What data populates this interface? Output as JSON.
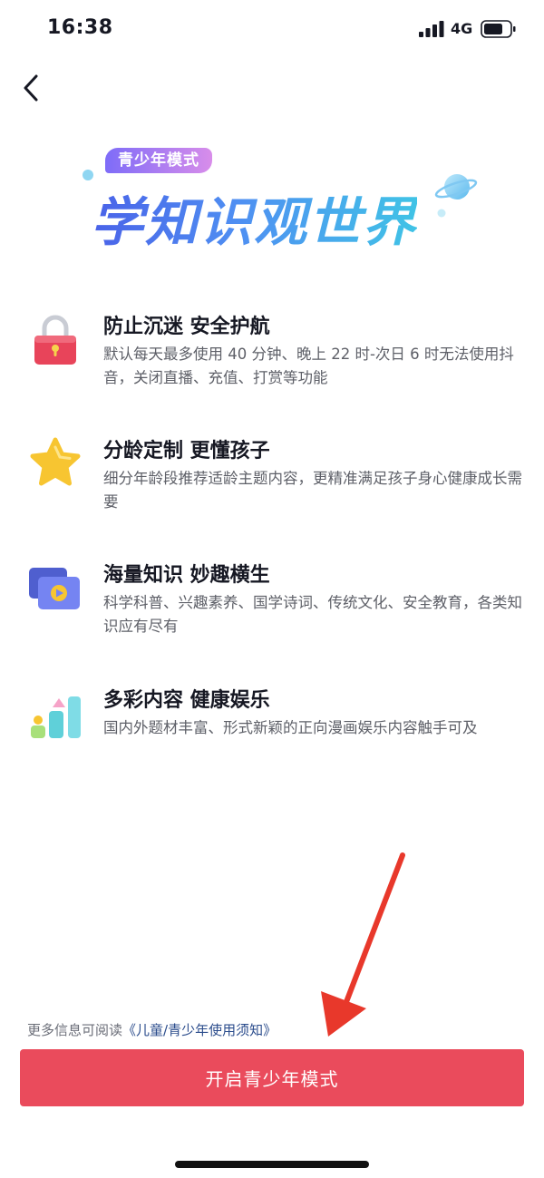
{
  "status_bar": {
    "time": "16:38",
    "network": "4G",
    "icons": [
      "signal-icon",
      "battery-icon"
    ]
  },
  "nav": {
    "back_icon": "chevron-left-icon"
  },
  "hero": {
    "badge": "青少年模式",
    "title": "学知识观世界"
  },
  "features": [
    {
      "icon": "lock-icon",
      "title": "防止沉迷 安全护航",
      "description": "默认每天最多使用 40 分钟、晚上 22 时-次日 6 时无法使用抖音，关闭直播、充值、打赏等功能"
    },
    {
      "icon": "star-icon",
      "title": "分龄定制 更懂孩子",
      "description": "细分年龄段推荐适龄主题内容，更精准满足孩子身心健康成长需要"
    },
    {
      "icon": "video-folder-icon",
      "title": "海量知识 妙趣横生",
      "description": "科学科普、兴趣素养、国学诗词、传统文化、安全教育，各类知识应有尽有"
    },
    {
      "icon": "shapes-icon",
      "title": "多彩内容 健康娱乐",
      "description": "国内外题材丰富、形式新颖的正向漫画娱乐内容触手可及"
    }
  ],
  "footer": {
    "info_prefix": "更多信息可阅读",
    "link_text": "《儿童/青少年使用须知》"
  },
  "primary_button": {
    "label": "开启青少年模式"
  },
  "colors": {
    "button": "#ea4b5c",
    "link": "#2b4c8c",
    "hero_gradient_start": "#4a62e8",
    "hero_gradient_end": "#40c3e6",
    "badge_gradient_start": "#7e6cf8",
    "badge_gradient_end": "#d88dea",
    "arrow": "#e8382b"
  }
}
